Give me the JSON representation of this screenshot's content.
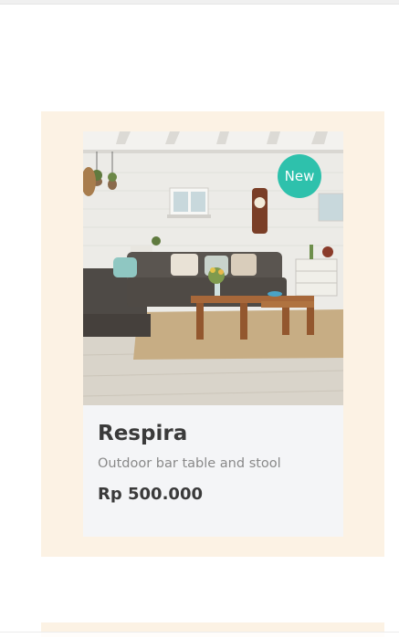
{
  "product": {
    "badge": "New",
    "name": "Respira",
    "description": "Outdoor bar table and stool",
    "price": "Rp 500.000",
    "image_alt": "living room with sofa and wooden coffee table"
  },
  "colors": {
    "section_bg": "#fcf2e4",
    "card_bg": "#f4f5f7",
    "badge_bg": "#2ec1ac",
    "title": "#3a3a3a",
    "subtitle": "#898989"
  }
}
